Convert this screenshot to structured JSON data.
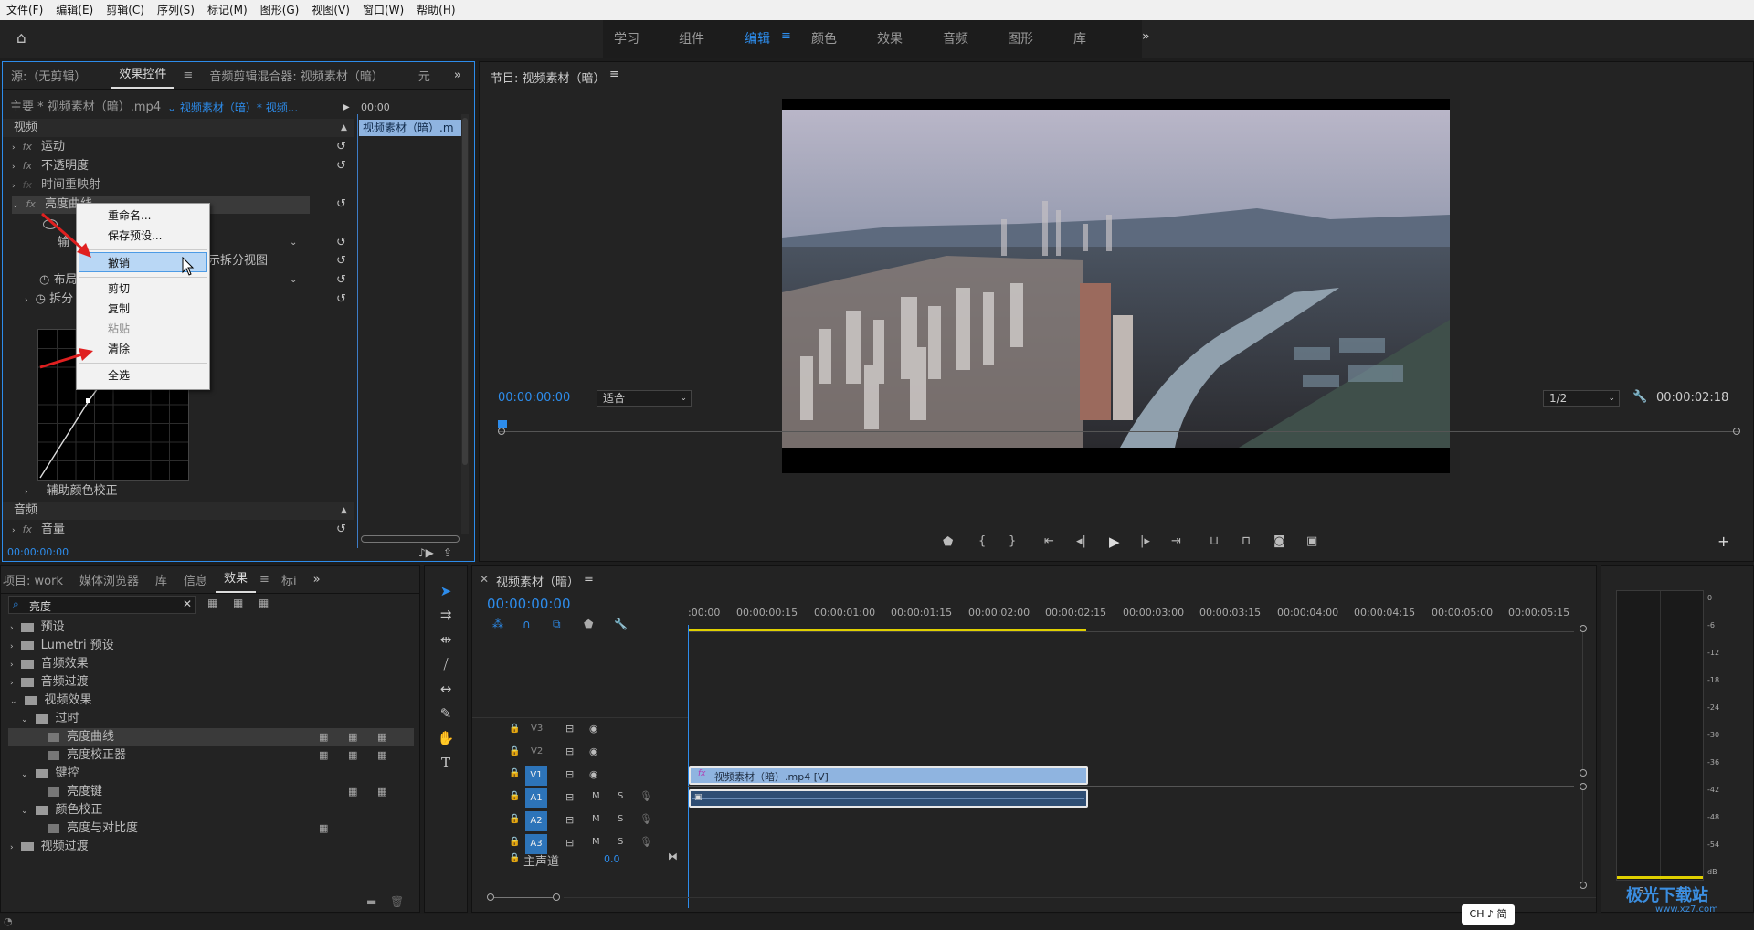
{
  "menu": [
    "文件(F)",
    "编辑(E)",
    "剪辑(C)",
    "序列(S)",
    "标记(M)",
    "图形(G)",
    "视图(V)",
    "窗口(W)",
    "帮助(H)"
  ],
  "workspaces": {
    "items": [
      "学习",
      "组件",
      "编辑",
      "颜色",
      "效果",
      "音频",
      "图形",
      "库"
    ],
    "active": "编辑",
    "more": "»"
  },
  "effect_controls": {
    "tabs": [
      "源:（无剪辑）",
      "效果控件",
      "音频剪辑混合器: 视频素材（暗）",
      "元"
    ],
    "active_tab": "效果控件",
    "master": "主要 * 视频素材（暗）.mp4",
    "sequence_clip": "视频素材（暗）* 视频...",
    "timecode_mini": "00:00",
    "clip_label": "视频素材（暗）.m",
    "section_video": "视频",
    "effects": [
      "运动",
      "不透明度",
      "时间重映射",
      "亮度曲线"
    ],
    "sub_labels": [
      "输",
      "布局",
      "拆分"
    ],
    "split_view_label": "示拆分视图",
    "aux_color": "辅助颜色校正",
    "section_audio": "音频",
    "audio_effect": "音量",
    "timecode": "00:00:00:00"
  },
  "context_menu": {
    "items": [
      "重命名...",
      "保存预设...",
      "撤销",
      "剪切",
      "复制",
      "粘贴",
      "清除",
      "全选"
    ],
    "highlighted": "撤销",
    "disabled": "粘贴"
  },
  "program_monitor": {
    "title": "节目: 视频素材（暗）",
    "timecode": "00:00:00:00",
    "fit": "适合",
    "resolution": "1/2",
    "duration": "00:00:02:18"
  },
  "project_panel": {
    "tabs": [
      "项目: work",
      "媒体浏览器",
      "库",
      "信息",
      "效果",
      "标i"
    ],
    "active_tab": "效果",
    "search_value": "亮度",
    "tree": [
      {
        "label": "预设",
        "depth": 0
      },
      {
        "label": "Lumetri 预设",
        "depth": 0
      },
      {
        "label": "音频效果",
        "depth": 0
      },
      {
        "label": "音频过渡",
        "depth": 0
      },
      {
        "label": "视频效果",
        "depth": 0
      },
      {
        "label": "过时",
        "depth": 1
      },
      {
        "label": "亮度曲线",
        "depth": 2
      },
      {
        "label": "亮度校正器",
        "depth": 2
      },
      {
        "label": "键控",
        "depth": 1
      },
      {
        "label": "亮度键",
        "depth": 2
      },
      {
        "label": "颜色校正",
        "depth": 1
      },
      {
        "label": "亮度与对比度",
        "depth": 2
      },
      {
        "label": "视频过渡",
        "depth": 0
      }
    ]
  },
  "timeline": {
    "title": "视频素材（暗）",
    "timecode": "00:00:00:00",
    "ruler": [
      ":00:00",
      "00:00:00:15",
      "00:00:01:00",
      "00:00:01:15",
      "00:00:02:00",
      "00:00:02:15",
      "00:00:03:00",
      "00:00:03:15",
      "00:00:04:00",
      "00:00:04:15",
      "00:00:05:00",
      "00:00:05:15"
    ],
    "tracks": [
      "V3",
      "V2",
      "V1",
      "A1",
      "A2",
      "A3"
    ],
    "master_label": "主声道",
    "master_value": "0.0",
    "clip_label": "视频素材（暗）.mp4 [V]",
    "fx": "fx"
  },
  "meter": {
    "scale": [
      "0",
      "-6",
      "-12",
      "-18",
      "-24",
      "-30",
      "-36",
      "-42",
      "-48",
      "-54",
      "dB"
    ],
    "solo": "S",
    "solo2": "S"
  },
  "ime": "CH ♪ 简",
  "watermark": "极光下载站",
  "watermark_url": "www.xz7.com"
}
